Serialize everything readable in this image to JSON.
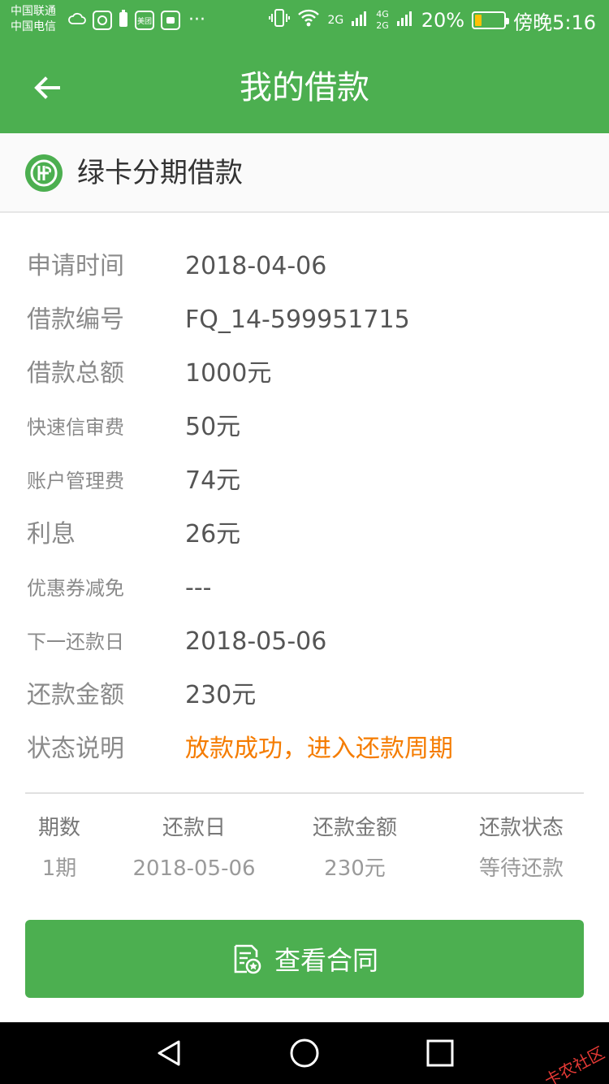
{
  "status_bar": {
    "carrier_1": "中国联通",
    "carrier_2": "中国电信",
    "signal_label_1": "2G",
    "signal_label_2": "4G\n2G",
    "battery_text": "20%",
    "battery_level": 0.2,
    "time": "傍晚5:16",
    "app_icon_text": "美团",
    "overflow_text": "···"
  },
  "app_bar": {
    "title": "我的借款",
    "back_icon": "arrow-left-icon"
  },
  "product": {
    "name": "绿卡分期借款"
  },
  "details": [
    {
      "label": "申请时间",
      "value": "2018-04-06",
      "size": "big"
    },
    {
      "label": "借款编号",
      "value": "FQ_14-599951715",
      "size": "big"
    },
    {
      "label": "借款总额",
      "value": "1000元",
      "size": "big"
    },
    {
      "label": "快速信审费",
      "value": "50元",
      "size": "small"
    },
    {
      "label": "账户管理费",
      "value": "74元",
      "size": "small"
    },
    {
      "label": "利息",
      "value": "26元",
      "size": "big"
    },
    {
      "label": "优惠券减免",
      "value": "---",
      "size": "small"
    },
    {
      "label": "下一还款日",
      "value": "2018-05-06",
      "size": "small"
    },
    {
      "label": "还款金额",
      "value": "230元",
      "size": "big"
    },
    {
      "label": "状态说明",
      "value": "放款成功，进入还款周期",
      "size": "big"
    }
  ],
  "installments": {
    "headers": [
      "期数",
      "还款日",
      "还款金额",
      "还款状态"
    ],
    "rows": [
      [
        "1期",
        "2018-05-06",
        "230元",
        "等待还款"
      ]
    ]
  },
  "contract_button": {
    "label": "查看合同",
    "icon": "contract-icon"
  },
  "watermark": "卡农社区",
  "colors": {
    "brand_green": "#4caf50",
    "status_orange": "#f57c00"
  }
}
